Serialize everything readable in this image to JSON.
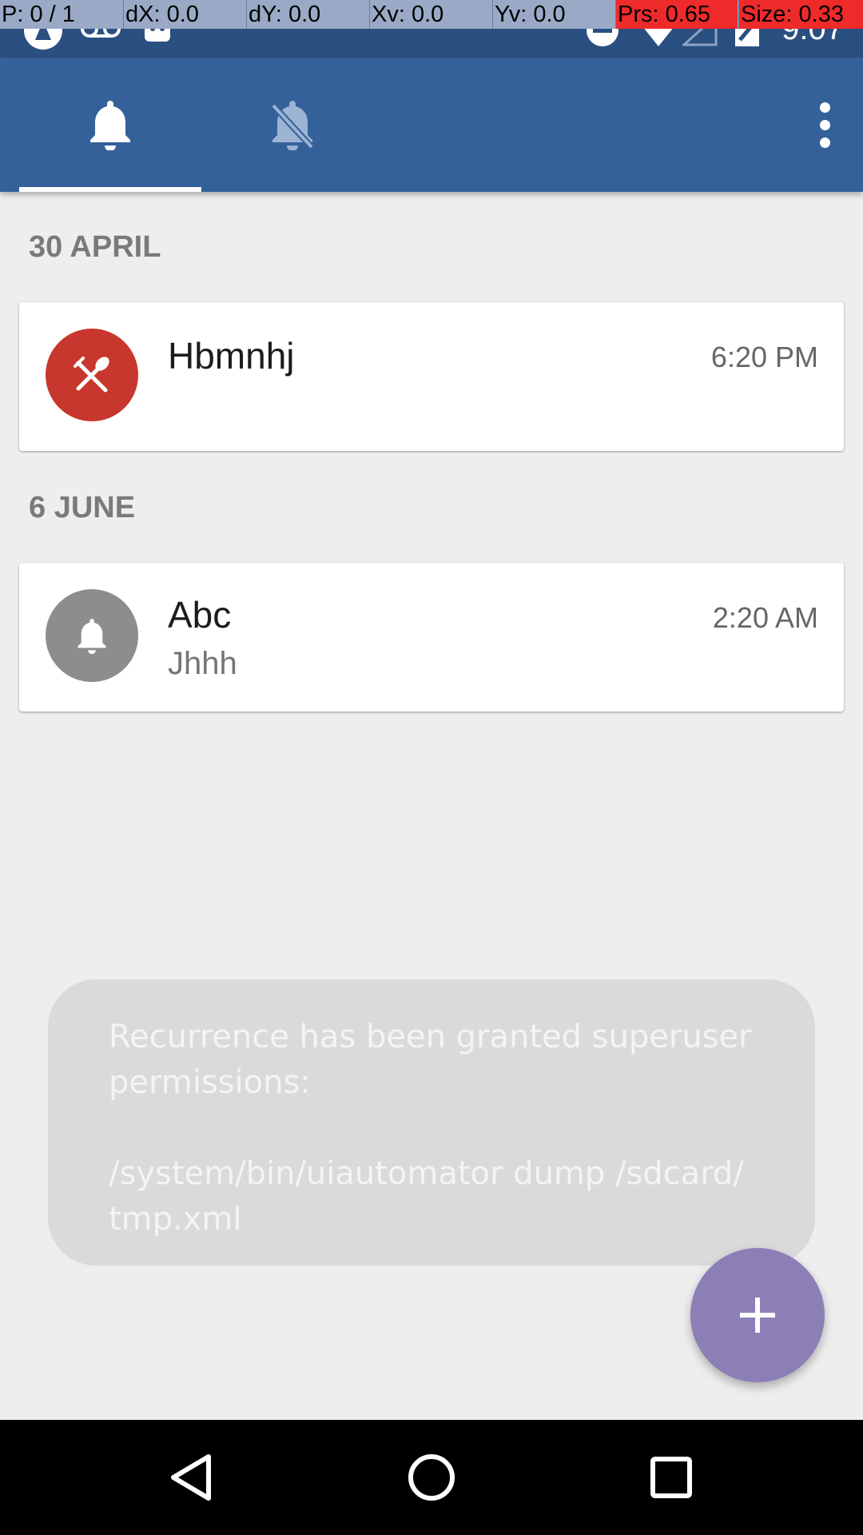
{
  "pointer_overlay": {
    "cells": [
      {
        "text": "P: 0 / 1",
        "highlight": false
      },
      {
        "text": "dX: 0.0",
        "highlight": false
      },
      {
        "text": "dY: 0.0",
        "highlight": false
      },
      {
        "text": "Xv: 0.0",
        "highlight": false
      },
      {
        "text": "Yv: 0.0",
        "highlight": false
      },
      {
        "text": "Prs: 0.65",
        "highlight": true
      },
      {
        "text": "Size: 0.33",
        "highlight": true
      }
    ]
  },
  "status_bar": {
    "time": "9:07",
    "icons": [
      "app-notification-icon",
      "voicemail-icon",
      "android-icon",
      "do-not-disturb-icon",
      "wifi-icon",
      "cell-signal-icon",
      "battery-icon"
    ]
  },
  "app_bar": {
    "tabs": [
      {
        "icon": "bell-icon",
        "selected": true
      },
      {
        "icon": "bell-off-icon",
        "selected": false
      }
    ],
    "menu_icon": "more-vert-icon"
  },
  "sections": [
    {
      "header": "30 APRIL",
      "items": [
        {
          "title": "Hbmnhj",
          "subtitle": "",
          "time": "6:20 PM",
          "icon": "utensils-icon",
          "color": "#c8372d"
        }
      ]
    },
    {
      "header": "6 JUNE",
      "items": [
        {
          "title": "Abc",
          "subtitle": "Jhhh",
          "time": "2:20 AM",
          "icon": "bell-icon",
          "color": "#8d8d8d"
        }
      ]
    }
  ],
  "toast": {
    "message": "Recurrence has been granted superuser\npermissions:\n\n/system/bin/uiautomator dump /sdcard/\ntmp.xml"
  },
  "fab": {
    "icon": "plus-icon",
    "color": "#8c7fb6"
  },
  "nav_bar": {
    "buttons": [
      "back-icon",
      "home-icon",
      "recents-icon"
    ]
  },
  "colors": {
    "status_bar": "#2a4f81",
    "app_bar": "#34619a",
    "background": "#eeeeee",
    "section_header": "#7a7a7a"
  }
}
